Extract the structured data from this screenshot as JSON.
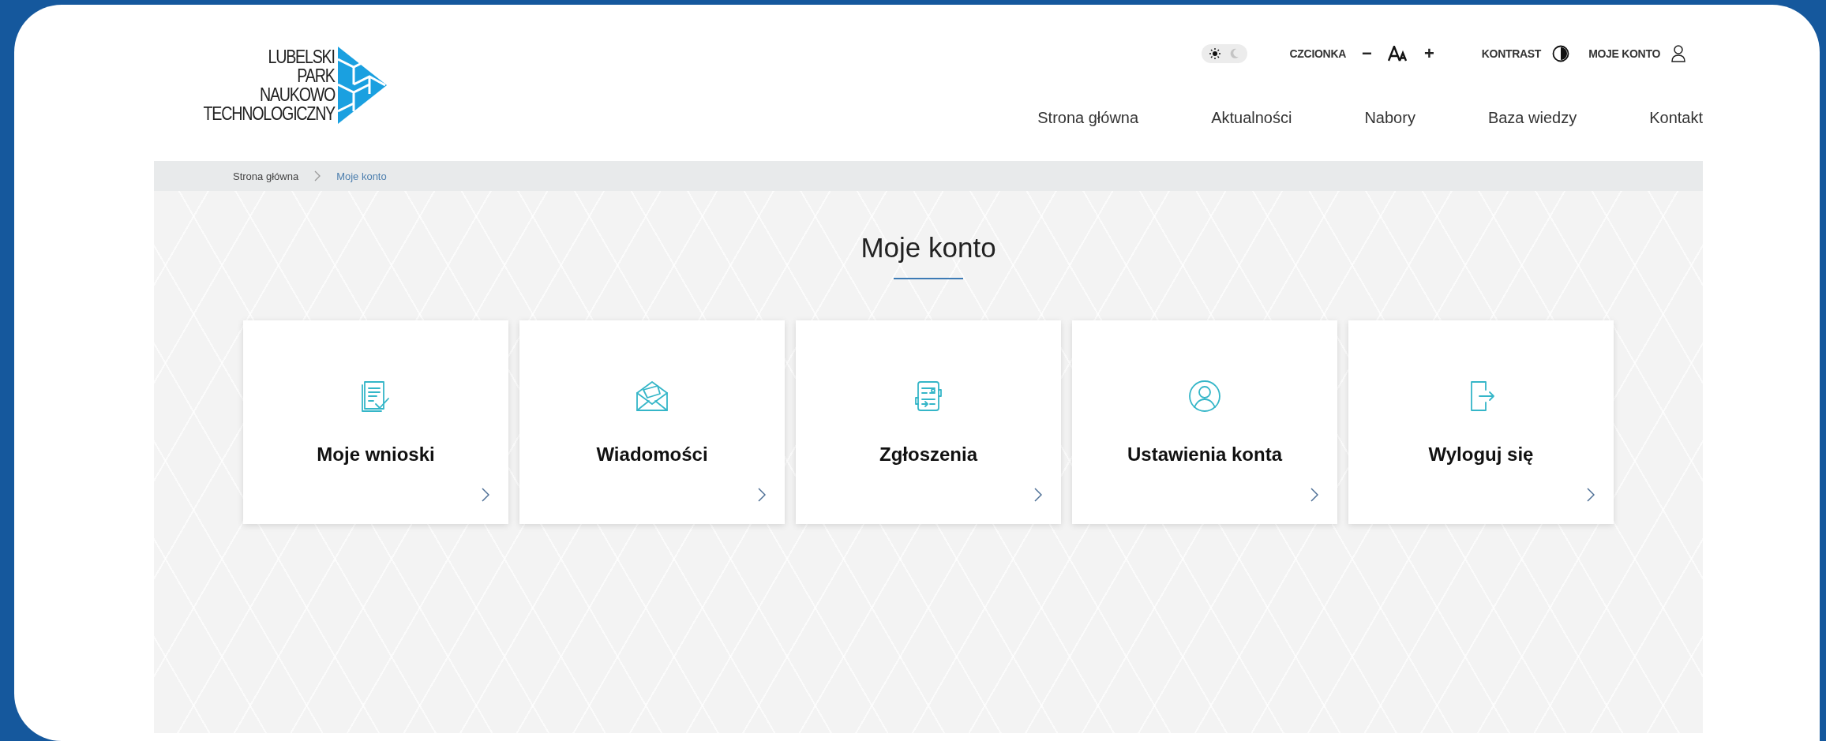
{
  "logo": {
    "lines": [
      "LUBELSKI",
      "PARK",
      "NAUKOWO",
      "TECHNOLOGICZNY"
    ]
  },
  "utility": {
    "dark_mode": false,
    "font_label": "CZCIONKA",
    "font_minus": "−",
    "font_plus": "+",
    "contrast_label": "KONTRAST",
    "account_label": "MOJE KONTO"
  },
  "nav": [
    {
      "label": "Strona główna"
    },
    {
      "label": "Aktualności"
    },
    {
      "label": "Nabory"
    },
    {
      "label": "Baza wiedzy"
    },
    {
      "label": "Kontakt"
    }
  ],
  "breadcrumb": [
    {
      "label": "Strona główna",
      "current": false
    },
    {
      "label": "Moje konto",
      "current": true
    }
  ],
  "page_title": "Moje konto",
  "cards": [
    {
      "kind": "documents",
      "title": "Moje wnioski"
    },
    {
      "kind": "envelope",
      "title": "Wiadomości"
    },
    {
      "kind": "form",
      "title": "Zgłoszenia"
    },
    {
      "kind": "user",
      "title": "Ustawienia konta"
    },
    {
      "kind": "logout",
      "title": "Wyloguj się"
    }
  ]
}
